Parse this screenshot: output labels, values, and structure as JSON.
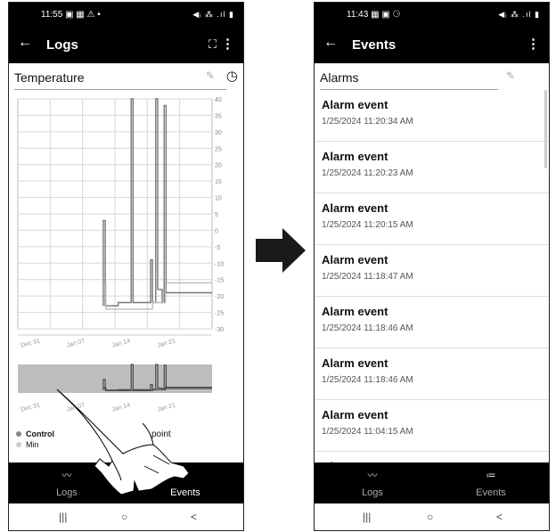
{
  "left_screen": {
    "status": {
      "time": "11:55",
      "left_icons": "▣ ▦ ⚠ •",
      "right_icons": "◀ᵢ ⁂ .ıl ▮"
    },
    "app_bar": {
      "back_icon": "←",
      "title": "Logs",
      "expand_icon": "⛶",
      "menu_icon": "⋮"
    },
    "section": {
      "title": "Temperature",
      "edit_icon": "✎",
      "history_icon": "◷"
    },
    "legend": [
      {
        "label": "Control",
        "color": "#888888"
      },
      {
        "label": "Min",
        "color": "#cccccc"
      }
    ],
    "legend_extra": "point",
    "bottom_nav": [
      {
        "icon": "〰",
        "label": "Logs"
      },
      {
        "icon": "",
        "label": "Events"
      }
    ],
    "system_nav": {
      "recents": "|||",
      "home": "○",
      "back": "<"
    }
  },
  "right_screen": {
    "status": {
      "time": "11:43",
      "left_icons": "▦ ▣ ⚆",
      "right_icons": "◀ᵢ ⁂ .ıl ▮"
    },
    "app_bar": {
      "back_icon": "←",
      "title": "Events",
      "menu_icon": "⋮"
    },
    "section": {
      "title": "Alarms",
      "edit_icon": "✎"
    },
    "events": [
      {
        "title": "Alarm event",
        "time": "1/25/2024 11:20:34 AM"
      },
      {
        "title": "Alarm event",
        "time": "1/25/2024 11:20:23 AM"
      },
      {
        "title": "Alarm event",
        "time": "1/25/2024 11:20:15 AM"
      },
      {
        "title": "Alarm event",
        "time": "1/25/2024 11:18:47 AM"
      },
      {
        "title": "Alarm event",
        "time": "1/25/2024 11:18:46 AM"
      },
      {
        "title": "Alarm event",
        "time": "1/25/2024 11:18:46 AM"
      },
      {
        "title": "Alarm event",
        "time": "1/25/2024 11:04:15 AM"
      },
      {
        "title": "Alarm event",
        "time": ""
      }
    ],
    "bottom_nav": [
      {
        "icon": "〰",
        "label": "Logs"
      },
      {
        "icon": "≔",
        "label": "Events"
      }
    ],
    "system_nav": {
      "recents": "|||",
      "home": "○",
      "back": "<"
    }
  },
  "chart_data": {
    "type": "line",
    "title": "Temperature",
    "x_tick_labels": [
      "Dec 31",
      "Jan 07",
      "Jan 14",
      "Jan 21"
    ],
    "y_tick_labels": [
      "40",
      "35",
      "30",
      "25",
      "20",
      "15",
      "10",
      "5",
      "0",
      "-5",
      "-10",
      "-15",
      "-20",
      "-25",
      "-30"
    ],
    "ylim": [
      -30,
      40
    ],
    "xlim": [
      -4,
      26
    ],
    "grid": true,
    "series": [
      {
        "color": "#777777",
        "points": [
          [
            9.2,
            -23
          ],
          [
            9.2,
            3
          ],
          [
            9.5,
            3
          ],
          [
            9.5,
            -23
          ],
          [
            11.5,
            -23
          ],
          [
            11.5,
            -22
          ],
          [
            13.5,
            -22
          ],
          [
            13.5,
            40
          ],
          [
            13.8,
            40
          ],
          [
            13.8,
            -22
          ],
          [
            16.5,
            -22
          ],
          [
            16.5,
            -9
          ],
          [
            16.8,
            -9
          ],
          [
            16.8,
            -22
          ],
          [
            17.3,
            -22
          ],
          [
            17.3,
            40
          ],
          [
            17.6,
            40
          ],
          [
            17.6,
            -18
          ],
          [
            18.3,
            -18
          ],
          [
            18.3,
            -22
          ],
          [
            18.6,
            -22
          ],
          [
            18.6,
            38
          ],
          [
            18.9,
            38
          ],
          [
            18.9,
            -19
          ],
          [
            26,
            -19
          ]
        ]
      },
      {
        "color": "#bbbbbb",
        "points": [
          [
            9.2,
            -17
          ],
          [
            9.6,
            -17
          ],
          [
            9.6,
            -24
          ],
          [
            16.8,
            -24
          ],
          [
            16.8,
            -22
          ],
          [
            18.8,
            -22
          ],
          [
            18.8,
            -16
          ],
          [
            26,
            -16
          ]
        ]
      }
    ],
    "overview_x_tick_labels": [
      "Dec 31",
      "Jan 07",
      "Jan 14",
      "Jan 21"
    ]
  }
}
